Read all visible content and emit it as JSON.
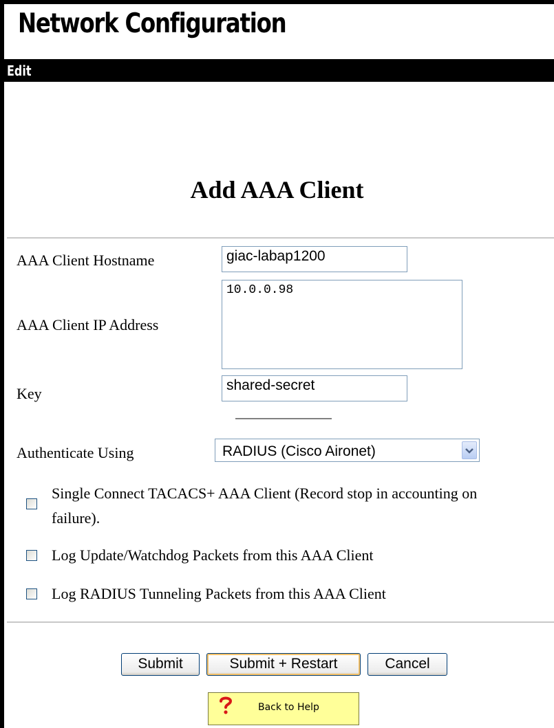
{
  "app": {
    "title": "Network Configuration"
  },
  "menu": {
    "edit": "Edit"
  },
  "form": {
    "title": "Add AAA Client",
    "hostname": {
      "label": "AAA Client Hostname",
      "value": "giac-labap1200"
    },
    "ip": {
      "label": "AAA Client IP Address",
      "value": "10.0.0.98"
    },
    "key": {
      "label": "Key",
      "value": "shared-secret"
    },
    "auth": {
      "label": "Authenticate Using",
      "selected": "RADIUS (Cisco Aironet)"
    },
    "options": [
      {
        "label": "Single Connect TACACS+ AAA Client (Record stop in accounting on failure).",
        "checked": false
      },
      {
        "label": "Log Update/Watchdog Packets from this AAA Client",
        "checked": false
      },
      {
        "label": "Log RADIUS Tunneling Packets from this AAA Client",
        "checked": false
      }
    ]
  },
  "buttons": {
    "submit": "Submit",
    "submit_restart": "Submit + Restart",
    "cancel": "Cancel",
    "back_to_help": "Back to Help"
  },
  "icons": {
    "help": "question-mark-icon",
    "dropdown": "chevron-down-icon"
  }
}
